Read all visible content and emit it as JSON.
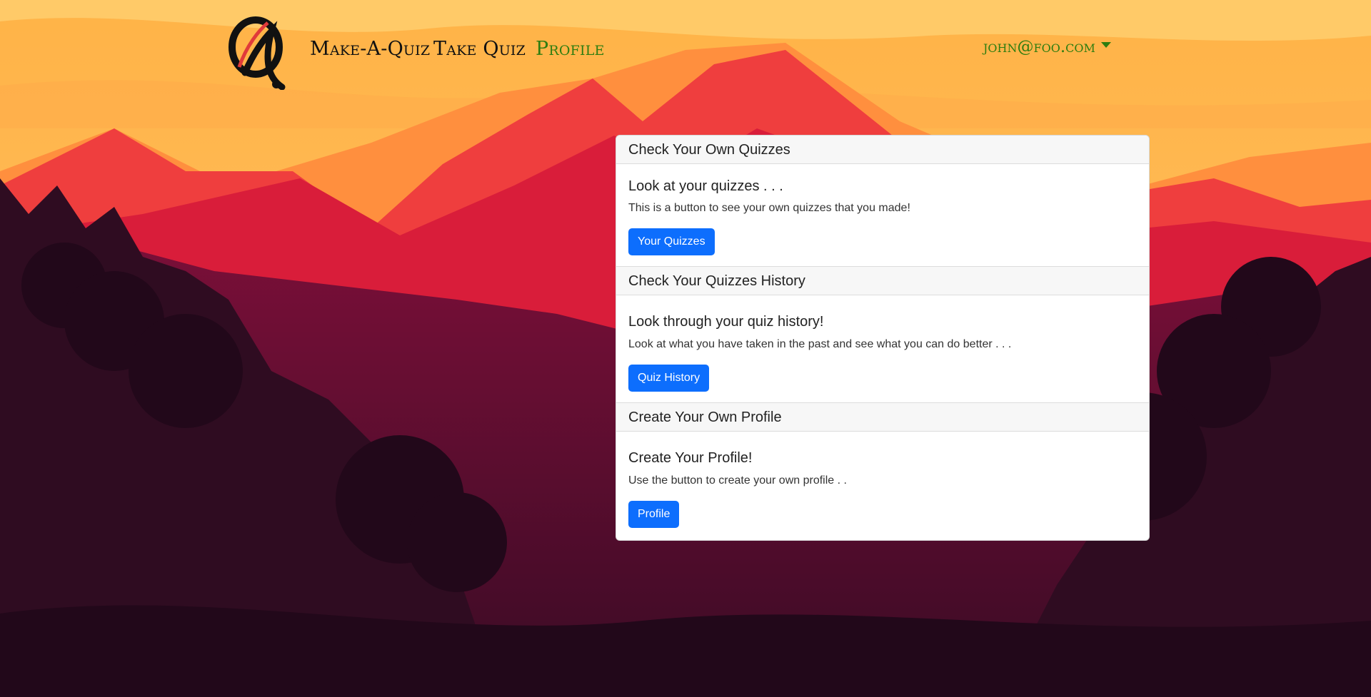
{
  "navbar": {
    "logo_letter": "Q",
    "links": [
      {
        "label": "Make-A-Quiz",
        "active": false
      },
      {
        "label": "Take Quiz",
        "active": false
      },
      {
        "label": "Profile",
        "active": true
      }
    ],
    "user_email": "john@foo.com"
  },
  "sections": [
    {
      "header": "Check Your Own Quizzes",
      "title": "Look at your quizzes . . .",
      "text": "This is a button to see your own quizzes that you made!",
      "button": "Your Quizzes"
    },
    {
      "header": "Check Your Quizzes History",
      "title": "Look through your quiz history!",
      "text": "Look at what you have taken in the past and see what you can do better . . .",
      "button": "Quiz History"
    },
    {
      "header": "Create Your Own Profile",
      "title": "Create Your Profile!",
      "text": "Use the button to create your own profile . .",
      "button": "Profile"
    }
  ],
  "colors": {
    "accent_green": "#2e7d10",
    "button_blue": "#0d6efd"
  }
}
